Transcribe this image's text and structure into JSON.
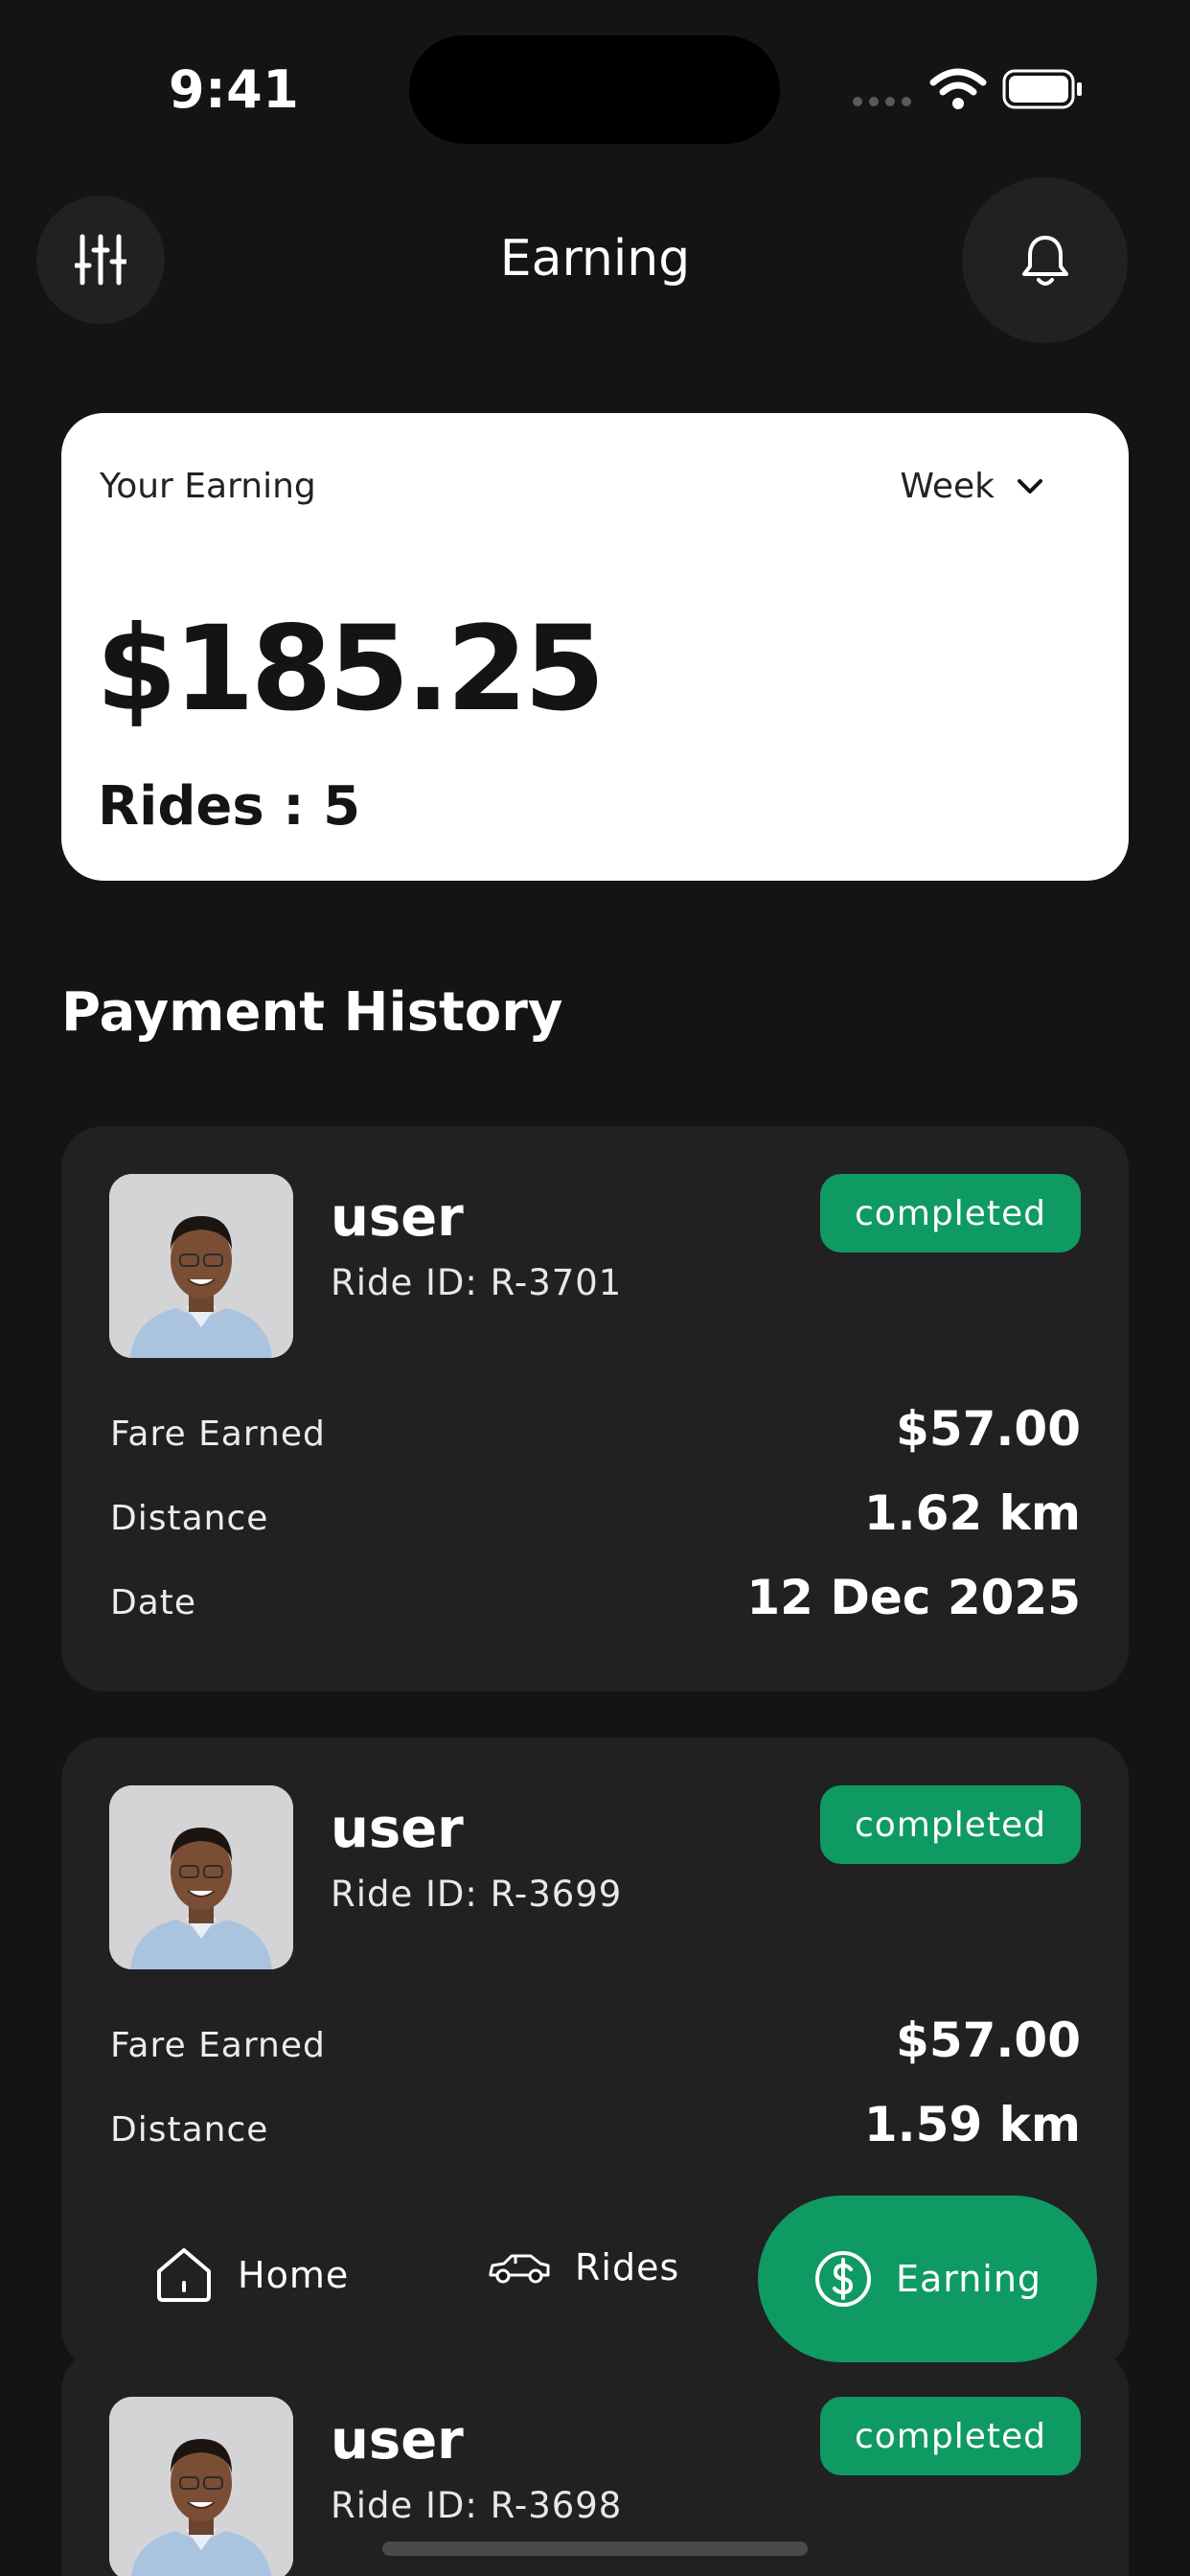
{
  "status_bar": {
    "time": "9:41"
  },
  "header": {
    "title": "Earning"
  },
  "earning_card": {
    "label": "Your Earning",
    "period": "Week",
    "amount": "$185.25",
    "rides": "Rides : 5"
  },
  "payment_history": {
    "title": "Payment History",
    "fare_label": "Fare Earned",
    "distance_label": "Distance",
    "date_label": "Date",
    "items": [
      {
        "name": "user",
        "ride_id": "Ride ID: R-3701",
        "status": "completed",
        "fare": "$57.00",
        "distance": "1.62 km",
        "date": "12 Dec 2025"
      },
      {
        "name": "user",
        "ride_id": "Ride ID: R-3699",
        "status": "completed",
        "fare": "$57.00",
        "distance": "1.59 km"
      },
      {
        "name": "user",
        "ride_id": "Ride ID: R-3698",
        "status": "completed"
      }
    ]
  },
  "bottom_nav": {
    "home": "Home",
    "rides": "Rides",
    "earning": "Earning",
    "active": "earning"
  },
  "colors": {
    "accent": "#0f9a63",
    "background": "#141414",
    "card": "#212121"
  }
}
